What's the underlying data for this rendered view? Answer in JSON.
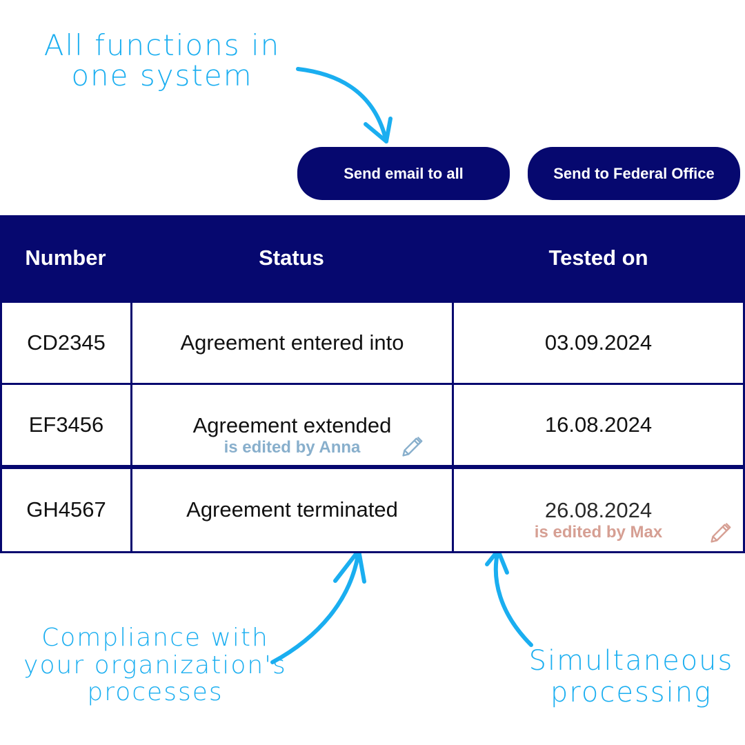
{
  "annotations": {
    "top": "All functions in one system",
    "compliance": "Compliance with your organization's processes",
    "simultaneous": "Simultaneous processing"
  },
  "toolbar": {
    "send_email_label": "Send email to all",
    "send_federal_label": "Send to Federal Office"
  },
  "table": {
    "headers": [
      "Number",
      "Status",
      "Tested on"
    ],
    "rows": [
      {
        "number": "CD2345",
        "status": "Agreement entered into",
        "tested_on": "03.09.2024"
      },
      {
        "number": "EF3456",
        "status": "Agreement extended",
        "tested_on": "16.08.2024",
        "status_editor": "is edited by Anna"
      },
      {
        "number": "GH4567",
        "status": "Agreement terminated",
        "tested_on": "26.08.2024",
        "date_editor": "is edited by Max"
      }
    ]
  },
  "colors": {
    "navy": "#06086f",
    "annotation_blue": "#1aaef0",
    "editor_anna": "#88afcc",
    "editor_max": "#d69f93"
  },
  "icons": {
    "edit_anna": "pencil-icon",
    "edit_max": "pencil-icon",
    "arrows": "hand-drawn-arrow-icon"
  }
}
